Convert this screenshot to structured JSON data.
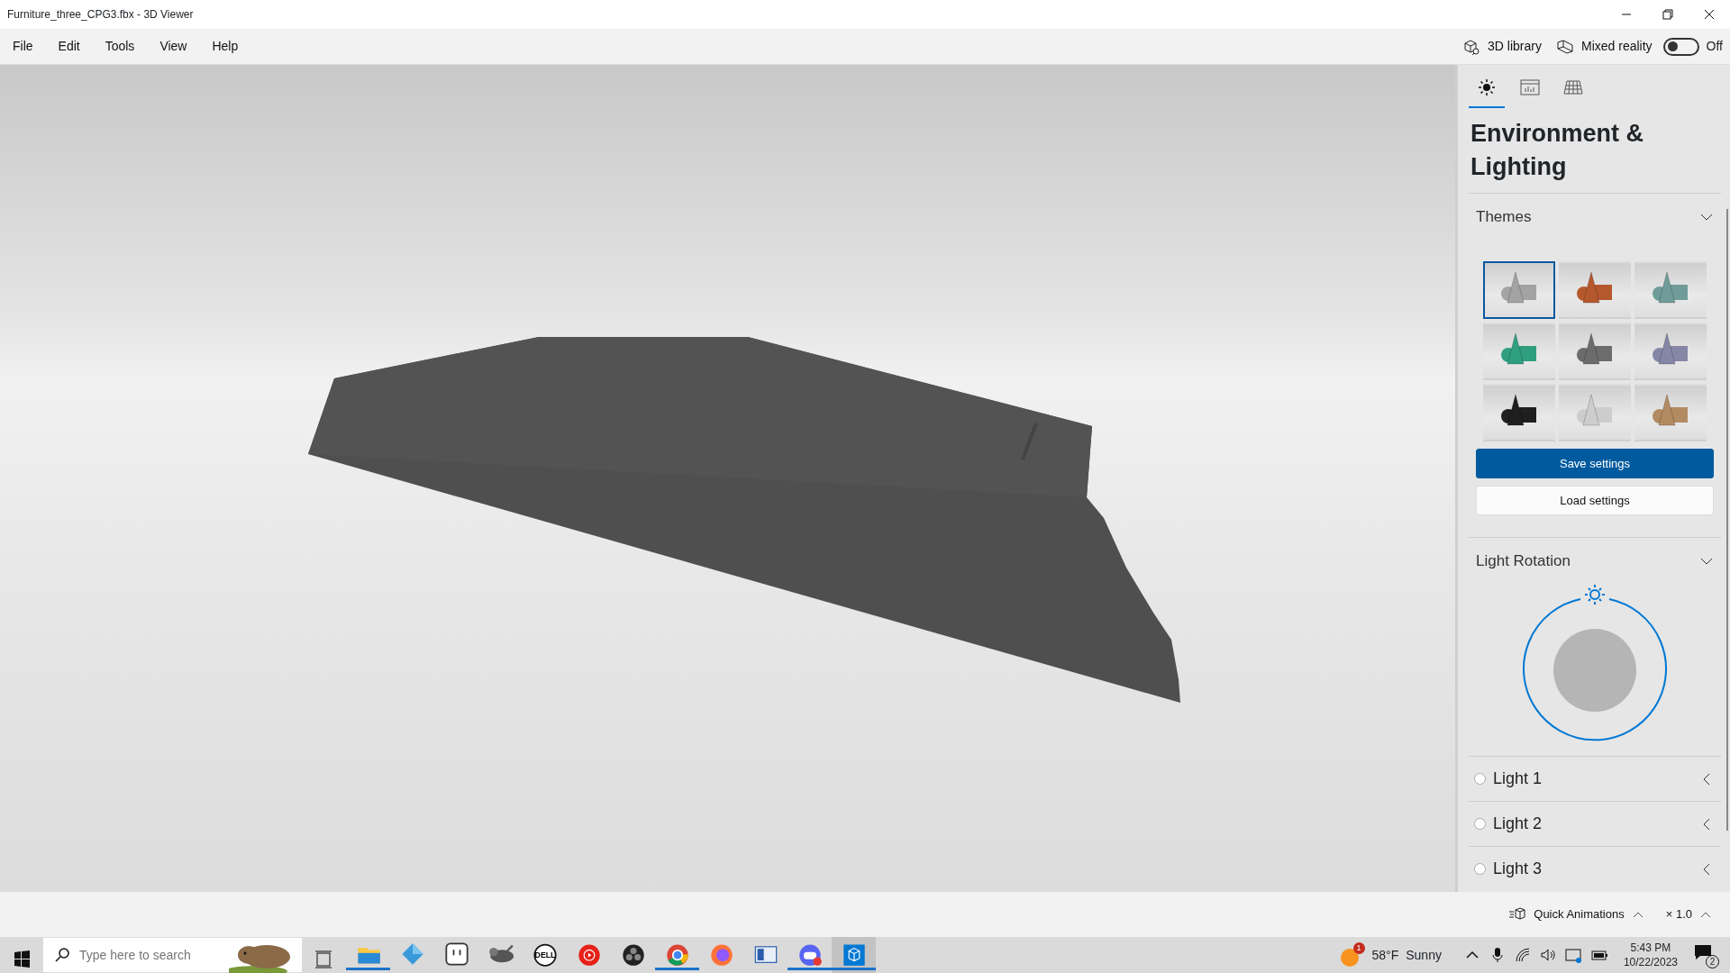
{
  "window": {
    "title": "Furniture_three_CPG3.fbx - 3D Viewer"
  },
  "menu": [
    "File",
    "Edit",
    "Tools",
    "View",
    "Help"
  ],
  "toolbar": {
    "library": "3D library",
    "mixed_reality": "Mixed reality",
    "toggle": {
      "on": false,
      "label": "Off"
    }
  },
  "panel": {
    "tabs": [
      {
        "kind": "sun",
        "selected": true
      },
      {
        "kind": "stats",
        "selected": false
      },
      {
        "kind": "grid",
        "selected": false
      }
    ],
    "title": "Environment & Lighting",
    "themes": {
      "label": "Themes",
      "expanded": true,
      "items": [
        {
          "color": "#a3a3a3",
          "selected": true
        },
        {
          "color": "#b5582e",
          "selected": false
        },
        {
          "color": "#6f9c99",
          "selected": false
        },
        {
          "color": "#2f9f80",
          "selected": false
        },
        {
          "color": "#6c6c6c",
          "selected": false
        },
        {
          "color": "#8686a6",
          "selected": false
        },
        {
          "color": "#1f1f1f",
          "selected": false
        },
        {
          "color": "#cdcdcd",
          "selected": false
        },
        {
          "color": "#b38b62",
          "selected": false
        }
      ]
    },
    "buttons": [
      {
        "label": "Save settings",
        "primary": true
      },
      {
        "label": "Load settings",
        "primary": false
      }
    ],
    "rotation": {
      "label": "Light Rotation",
      "expanded": true
    },
    "lights": [
      {
        "label": "Light 1",
        "checked": false,
        "expanded": false
      },
      {
        "label": "Light 2",
        "checked": false,
        "expanded": false
      },
      {
        "label": "Light 3",
        "checked": false,
        "expanded": false
      }
    ]
  },
  "status_bar": {
    "animations": "Quick Animations",
    "speed": "× 1.0"
  },
  "taskbar": {
    "search": {
      "placeholder": "Type here to search"
    },
    "apps": [
      {
        "kind": "folder",
        "running": true,
        "selected": false
      },
      {
        "kind": "diamond",
        "running": false,
        "selected": false
      },
      {
        "kind": "chat",
        "running": false,
        "selected": false
      },
      {
        "kind": "animal",
        "running": false,
        "selected": false
      },
      {
        "kind": "dell",
        "text": "DELL",
        "running": false,
        "selected": false
      },
      {
        "kind": "play",
        "running": false,
        "selected": false
      },
      {
        "kind": "obs",
        "running": false,
        "selected": false
      },
      {
        "kind": "chrome",
        "running": true,
        "selected": false
      },
      {
        "kind": "firefox",
        "running": false,
        "selected": false
      },
      {
        "kind": "reader",
        "running": false,
        "selected": false
      },
      {
        "kind": "discord",
        "running": true,
        "selected": false
      },
      {
        "kind": "cube",
        "running": true,
        "selected": true
      }
    ],
    "weather": {
      "temp": "58°F",
      "condition": "Sunny",
      "badge": "1"
    },
    "clock": {
      "time": "5:43 PM",
      "date": "10/22/2023"
    },
    "notifications": "2"
  }
}
